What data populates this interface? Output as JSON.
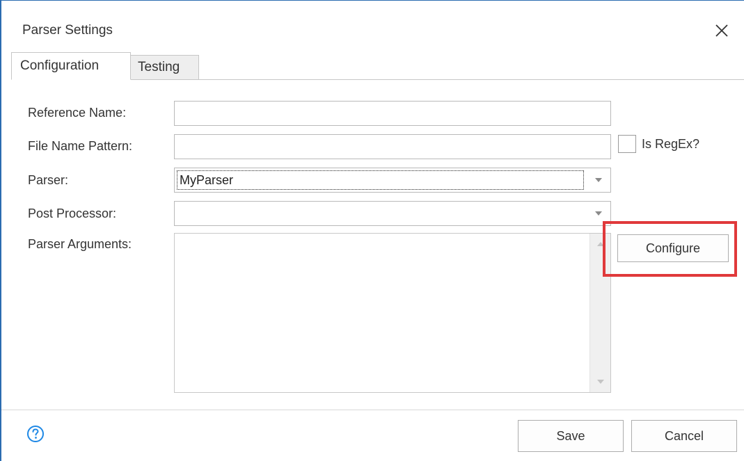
{
  "dialog": {
    "title": "Parser Settings",
    "close_icon": "close-icon"
  },
  "tabs": [
    {
      "label": "Configuration",
      "active": true
    },
    {
      "label": "Testing",
      "active": false
    }
  ],
  "form": {
    "reference_name": {
      "label": "Reference Name:",
      "value": ""
    },
    "file_name_pattern": {
      "label": "File Name Pattern:",
      "value": "",
      "regex_label": "Is RegEx?",
      "regex_checked": false
    },
    "parser": {
      "label": "Parser:",
      "value": "MyParser"
    },
    "post_processor": {
      "label": "Post Processor:",
      "value": ""
    },
    "parser_arguments": {
      "label": "Parser Arguments:",
      "value": ""
    }
  },
  "buttons": {
    "configure": "Configure",
    "save": "Save",
    "cancel": "Cancel"
  },
  "icons": {
    "help": "help-icon",
    "dropdown": "chevron-down-icon"
  },
  "colors": {
    "accent": "#2b6cb0",
    "highlight": "#e0393b",
    "help_blue": "#1e88e5"
  }
}
